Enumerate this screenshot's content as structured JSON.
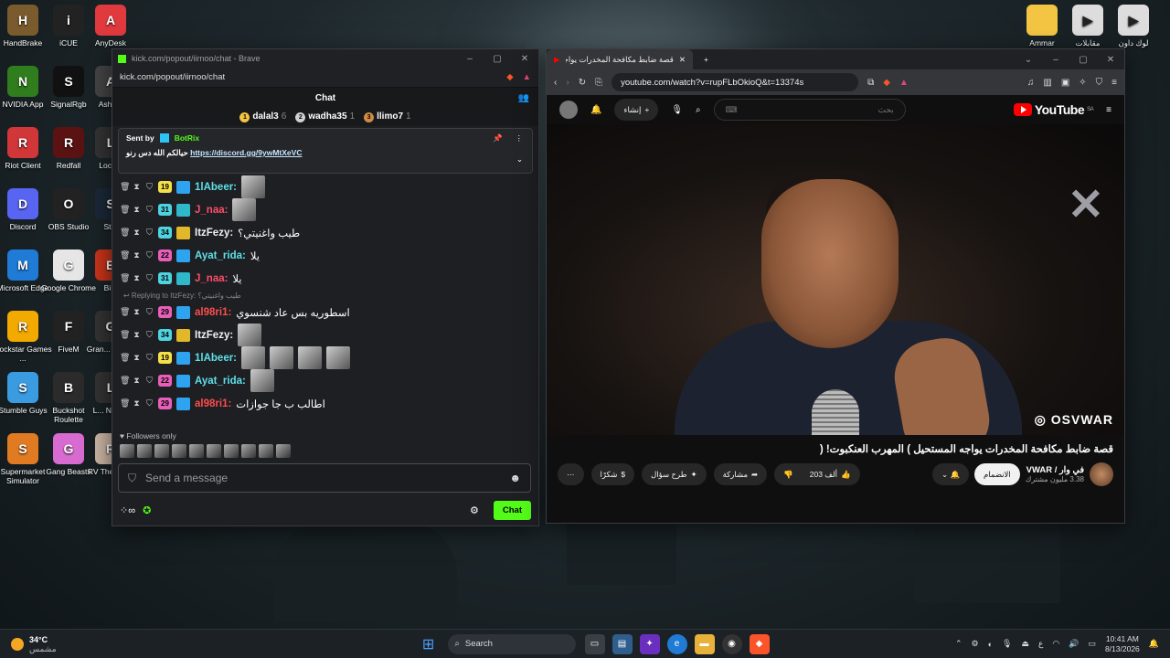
{
  "desktop": {
    "icons": [
      {
        "label": "HandBrake",
        "color": "#7a5b2d"
      },
      {
        "label": "iCUE",
        "color": "#222"
      },
      {
        "label": "AnyDesk",
        "color": "#e0393e"
      },
      {
        "label": "NVIDIA App",
        "color": "#2f7d1c"
      },
      {
        "label": "SignalRgb",
        "color": "#111"
      },
      {
        "label": "Ashe...",
        "color": "#444"
      },
      {
        "label": "Riot Client",
        "color": "#d13639"
      },
      {
        "label": "Redfall",
        "color": "#5a1212"
      },
      {
        "label": "Loca...",
        "color": "#333"
      },
      {
        "label": "Discord",
        "color": "#5865f2"
      },
      {
        "label": "OBS Studio",
        "color": "#222"
      },
      {
        "label": "St...",
        "color": "#1b2838"
      },
      {
        "label": "Microsoft Edge",
        "color": "#1f7bd6"
      },
      {
        "label": "Google Chrome",
        "color": "#e6e6e6"
      },
      {
        "label": "Bi...",
        "color": "#c9331a"
      },
      {
        "label": "Rockstar Games ...",
        "color": "#f2a900"
      },
      {
        "label": "FiveM",
        "color": "#222"
      },
      {
        "label": "Gran... Auto...",
        "color": "#333"
      },
      {
        "label": "Stumble Guys",
        "color": "#3a9be0"
      },
      {
        "label": "Buckshot Roulette",
        "color": "#2b2b2b"
      },
      {
        "label": "L... Nigh...",
        "color": "#333"
      },
      {
        "label": "Supermarket Simulator",
        "color": "#e07b22"
      },
      {
        "label": "Gang Beasts",
        "color": "#d86bd0"
      },
      {
        "label": "RV There Yet",
        "color": "#cbb6a5"
      }
    ],
    "right_icons": [
      {
        "label": "Ammar",
        "color": "#f4c542"
      },
      {
        "label": "مقابلات",
        "color": "#ddd"
      },
      {
        "label": "لوك داون",
        "color": "#ddd"
      }
    ]
  },
  "chat_window": {
    "title": "kick.com/popout/iirnoo/chat - Brave",
    "url": "kick.com/popout/iirnoo/chat",
    "header": "Chat",
    "leaderboard": [
      {
        "rank": "1",
        "name": "dalal3",
        "count": "6",
        "color": "#f5c542"
      },
      {
        "rank": "2",
        "name": "wadha35",
        "count": "1",
        "color": "#d0d0d0"
      },
      {
        "rank": "3",
        "name": "llimo7",
        "count": "1",
        "color": "#d18b47"
      }
    ],
    "pinned": {
      "sent_by": "Sent by",
      "bot": "BotRix",
      "text": "حيالكم الله دس رنو",
      "link": "https://discord.gg/9ywMtXeVC"
    },
    "messages": [
      {
        "sub": "19",
        "sub_color": "#f5e04a",
        "name": "1lAbeer:",
        "name_color": "#5fe0e8",
        "text": "",
        "emotes": 1,
        "reply": ""
      },
      {
        "sub": "31",
        "sub_color": "#4fd3e0",
        "name": "J_naa:",
        "name_color": "#ff4d6a",
        "text": "",
        "emotes": 1,
        "reply": ""
      },
      {
        "sub": "34",
        "sub_color": "#4fd3e0",
        "name": "ItzFezy:",
        "name_color": "#f0f0f0",
        "text": "طيب واغنيتي؟",
        "emotes": 0,
        "reply": ""
      },
      {
        "sub": "22",
        "sub_color": "#e75fb8",
        "name": "Ayat_rida:",
        "name_color": "#5fe0e8",
        "text": "يلا",
        "emotes": 0,
        "reply": ""
      },
      {
        "sub": "31",
        "sub_color": "#4fd3e0",
        "name": "J_naa:",
        "name_color": "#ff4d6a",
        "text": "يلا",
        "emotes": 0,
        "reply": ""
      },
      {
        "sub": "29",
        "sub_color": "#e75fb8",
        "name": "al98ri1:",
        "name_color": "#ff4d4d",
        "text": "اسطوريه بس عاد شنسوي",
        "emotes": 0,
        "reply": "Replying to ItzFezy: طيب واغنيتي؟"
      },
      {
        "sub": "34",
        "sub_color": "#4fd3e0",
        "name": "ItzFezy:",
        "name_color": "#f0f0f0",
        "text": "",
        "emotes": 1,
        "reply": ""
      },
      {
        "sub": "19",
        "sub_color": "#f5e04a",
        "name": "1lAbeer:",
        "name_color": "#5fe0e8",
        "text": "",
        "emotes": 4,
        "reply": ""
      },
      {
        "sub": "22",
        "sub_color": "#e75fb8",
        "name": "Ayat_rida:",
        "name_color": "#5fe0e8",
        "text": "",
        "emotes": 1,
        "reply": ""
      },
      {
        "sub": "29",
        "sub_color": "#e75fb8",
        "name": "al98ri1:",
        "name_color": "#ff4d4d",
        "text": "اطالب ب جا جوازات",
        "emotes": 0,
        "reply": ""
      }
    ],
    "followers_only": "Followers only",
    "input_placeholder": "Send a message",
    "chat_button": "Chat"
  },
  "youtube_window": {
    "tab_title": "قصة ضابط مكافحة المخدرات يواجه",
    "url": "youtube.com/watch?v=rupFLbOkioQ&t=13374s",
    "create_label": "إنشاء",
    "search_placeholder": "بحث",
    "logo": "YouTube",
    "region": "SA",
    "watermark": "OSVWAR",
    "video_title": "قصة ضابط مكافحة المخدرات يواجه المستحيل ) المهرب العنكبوت! (",
    "channel_name": "في وار / VWAR",
    "subscribers": "3.38 مليون مشترك",
    "subscribe": "الانضمام",
    "likes": "203 ألف",
    "share": "مشاركة",
    "ask": "طرح سؤال",
    "thanks": "شكرًا"
  },
  "taskbar": {
    "weather_temp": "34°C",
    "weather_desc": "مشمس",
    "search": "Search",
    "lang": "ع",
    "time": "10:41 AM",
    "date": "8/13/2026"
  }
}
